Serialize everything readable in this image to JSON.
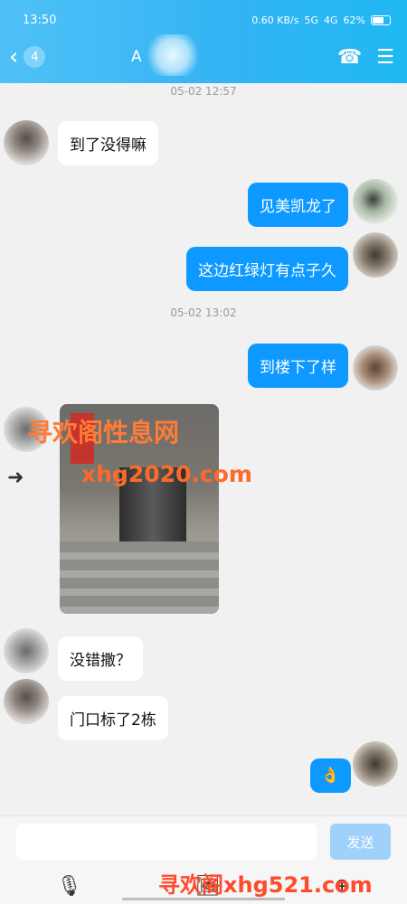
{
  "status": {
    "time": "13:50",
    "network_speed": "0.60 KB/s",
    "signal_5g": "5G",
    "signal_4g": "4G",
    "battery": "62%"
  },
  "header": {
    "back_label": "<",
    "unread_count": "4",
    "title": "A",
    "icons": [
      "phone-icon",
      "menu-icon"
    ]
  },
  "timestamps": [
    "05-02 12:57",
    "05-02 13:02"
  ],
  "messages": [
    {
      "side": "in",
      "text": "到了没得嘛"
    },
    {
      "side": "out",
      "text": "见美凯龙了"
    },
    {
      "side": "out",
      "text": "这边红绿灯有点子久"
    },
    {
      "side": "out",
      "text": "到楼下了样"
    },
    {
      "side": "in",
      "text": "没错撒？"
    },
    {
      "side": "in",
      "text": "门口标了2栋"
    },
    {
      "side": "out",
      "text": "👌"
    }
  ],
  "watermarks": {
    "image_1": "寻欢阁性息网",
    "image_2": "xhg2020.com",
    "bottom": "寻欢阁xhg521.com"
  },
  "composer": {
    "send_label": "发送"
  },
  "toolbar": {
    "icons": [
      "microphone-icon",
      "image-icon",
      "plus-icon"
    ]
  }
}
